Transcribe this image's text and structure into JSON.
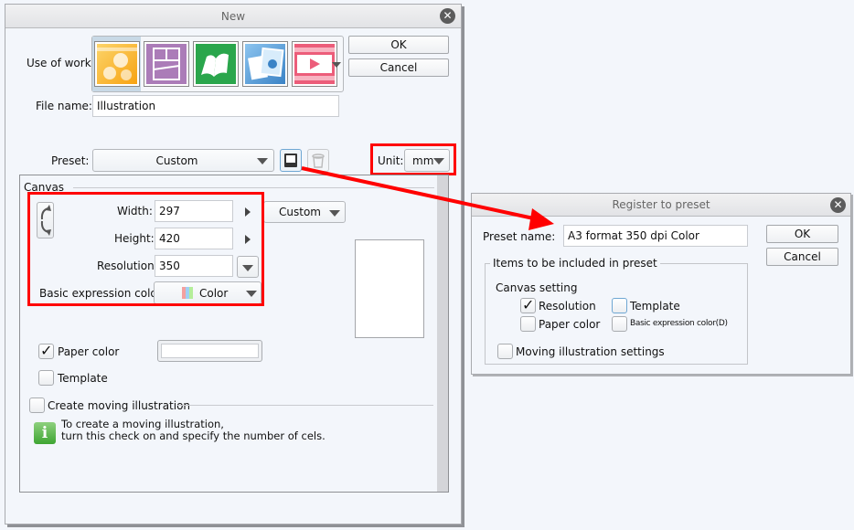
{
  "new_dialog": {
    "title": "New",
    "use_of_work_label": "Use of work",
    "use_of_work_options": [
      {
        "name": "Illustration",
        "icon": "illustration-icon",
        "color": "#f9a81a",
        "selected": true
      },
      {
        "name": "Comic",
        "icon": "comic-icon",
        "color": "#a97bb5",
        "selected": false
      },
      {
        "name": "Book",
        "icon": "book-icon",
        "color": "#2daa4f",
        "selected": false
      },
      {
        "name": "Multi-page",
        "icon": "multipage-icon",
        "color": "#4a90d0",
        "selected": false
      },
      {
        "name": "Animation",
        "icon": "animation-icon",
        "color": "#ea5a78",
        "selected": false
      }
    ],
    "ok_label": "OK",
    "cancel_label": "Cancel",
    "file_name_label": "File name:",
    "file_name_value": "Illustration",
    "preset_label": "Preset:",
    "preset_value": "Custom",
    "unit_label": "Unit:",
    "unit_value": "mm",
    "canvas_group_label": "Canvas",
    "width_label": "Width:",
    "width_value": "297",
    "height_label": "Height:",
    "height_value": "420",
    "size_preset_value": "Custom",
    "resolution_label": "Resolution:",
    "resolution_value": "350",
    "expression_color_label": "Basic expression color:",
    "expression_color_value": "Color",
    "paper_color_label": "Paper color",
    "paper_color_checked": true,
    "template_label": "Template",
    "template_checked": false,
    "moving_illustration_label": "Create moving illustration",
    "moving_illustration_checked": false,
    "info_line1": "To create a moving illustration,",
    "info_line2": "turn this check on and specify the number of cels."
  },
  "register_dialog": {
    "title": "Register to preset",
    "preset_name_label": "Preset name:",
    "preset_name_value": "A3 format 350 dpi Color",
    "ok_label": "OK",
    "cancel_label": "Cancel",
    "items_group_label": "Items to be included in preset",
    "canvas_setting_label": "Canvas setting",
    "resolution_label": "Resolution",
    "resolution_checked": true,
    "template_label": "Template",
    "template_checked": false,
    "paper_color_label": "Paper color",
    "paper_color_checked": false,
    "expression_color_label": "Basic expression color(D)",
    "expression_color_checked": false,
    "moving_settings_label": "Moving illustration settings",
    "moving_settings_checked": false
  },
  "annotation": {
    "highlight_color": "#ff0000"
  }
}
